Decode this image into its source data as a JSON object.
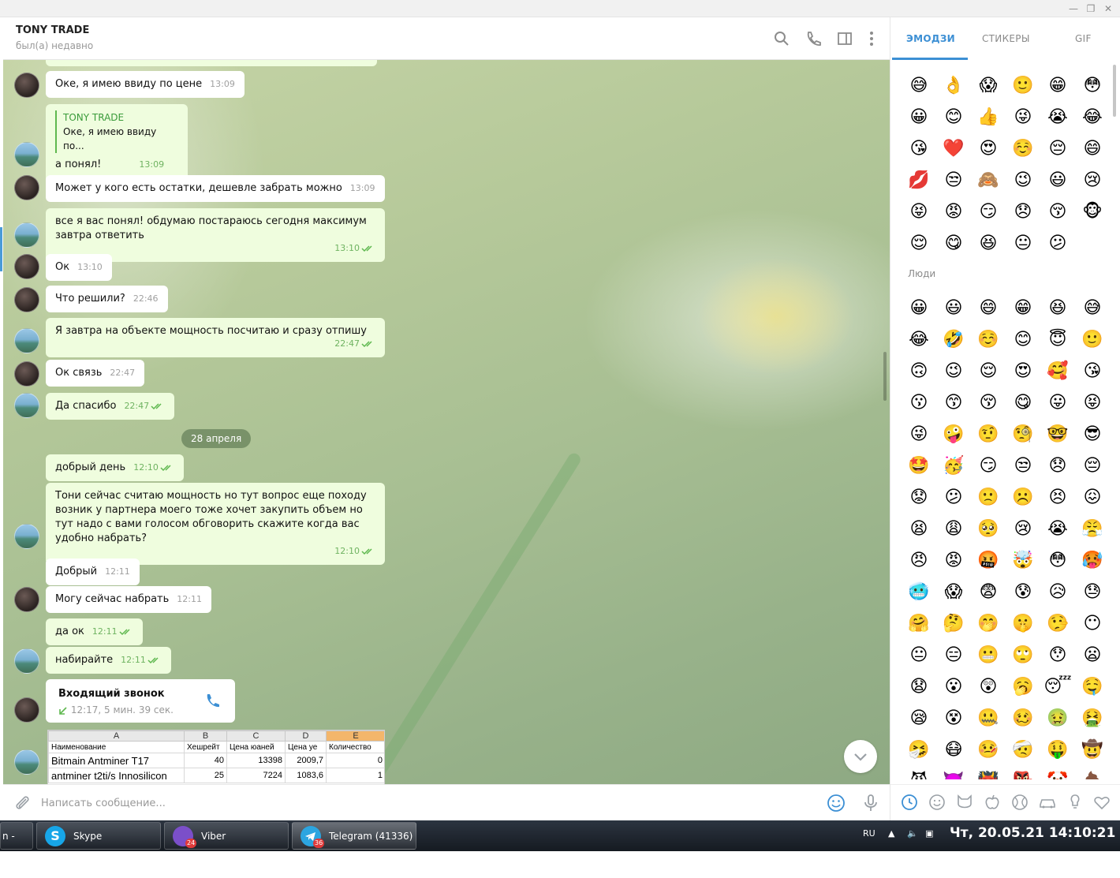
{
  "chat": {
    "title": "TONY TRADE",
    "status": "был(а) недавно"
  },
  "messages": [
    {
      "text": "Оке, я имею ввиду по цене",
      "time": "13:09"
    },
    {
      "reply_name": "TONY TRADE",
      "reply_text": "Оке, я имею ввиду по...",
      "text": "а понял!",
      "time": "13:09"
    },
    {
      "text": "Может у кого есть остатки, дешевле забрать можно",
      "time": "13:09"
    },
    {
      "text": "все я вас понял! обдумаю постараюсь сегодня максимум завтра ответить",
      "time": "13:10"
    },
    {
      "text": "Ок",
      "time": "13:10"
    },
    {
      "text": "Что решили?",
      "time": "22:46"
    },
    {
      "text": "Я завтра на объекте мощность посчитаю и сразу отпишу",
      "time": "22:47"
    },
    {
      "text": "Ок связь",
      "time": "22:47"
    },
    {
      "text": "Да спасибо",
      "time": "22:47"
    },
    {
      "text": "добрый день",
      "time": "12:10"
    },
    {
      "text": "Тони сейчас считаю мощность но тут вопрос еще походу возник у партнера моего тоже хочет закупить объем но тут надо с вами голосом обговорить скажите когда вас удобно набрать?",
      "time": "12:10"
    },
    {
      "text": "Добрый",
      "time": "12:11"
    },
    {
      "text": "Могу сейчас набрать",
      "time": "12:11"
    },
    {
      "text": "да ок",
      "time": "12:11"
    },
    {
      "text": "набирайте",
      "time": "12:11"
    }
  ],
  "date_separator": "28 апреля",
  "call": {
    "title": "Входящий звонок",
    "details": "12:17, 5 мин. 39 сек."
  },
  "spreadsheet": {
    "col_letters": [
      "A",
      "B",
      "C",
      "D",
      "E"
    ],
    "headers": [
      "Наименование",
      "Хешрейт",
      "Цена юаней",
      "Цена уе",
      "Количество"
    ],
    "rows": [
      [
        "Bitmain Antminer T17",
        "40",
        "13398",
        "2009,7",
        "0"
      ],
      [
        "antminer t2ti/s Innosilicon",
        "25",
        "7224",
        "1083,6",
        "1"
      ]
    ]
  },
  "composer": {
    "placeholder": "Написать сообщение..."
  },
  "emoji_panel": {
    "tabs": [
      "ЭМОДЗИ",
      "СТИКЕРЫ",
      "GIF"
    ],
    "people_label": "Люди",
    "recent": [
      "😅",
      "👌",
      "😱",
      "🙂",
      "😁",
      "😳",
      "😀",
      "😊",
      "👍",
      "😜",
      "😭",
      "😂",
      "😘",
      "❤️",
      "😍",
      "☺️",
      "😔",
      "😄",
      "💋",
      "😒",
      "🙈",
      "😉",
      "😃",
      "😢",
      "😝",
      "😡",
      "😏",
      "😞",
      "😚",
      "🐵",
      "😌",
      "😋",
      "😆",
      "😐",
      "😕"
    ],
    "people": [
      "😀",
      "😃",
      "😄",
      "😁",
      "😆",
      "😅",
      "😂",
      "🤣",
      "☺️",
      "😊",
      "😇",
      "🙂",
      "🙃",
      "😉",
      "😌",
      "😍",
      "🥰",
      "😘",
      "😗",
      "😙",
      "😚",
      "😋",
      "😛",
      "😝",
      "😜",
      "🤪",
      "🤨",
      "🧐",
      "🤓",
      "😎",
      "🤩",
      "🥳",
      "😏",
      "😒",
      "😞",
      "😔",
      "😟",
      "😕",
      "🙁",
      "☹️",
      "😣",
      "😖",
      "😫",
      "😩",
      "🥺",
      "😢",
      "😭",
      "😤",
      "😠",
      "😡",
      "🤬",
      "🤯",
      "😳",
      "🥵",
      "🥶",
      "😱",
      "😨",
      "😰",
      "😥",
      "😓",
      "🤗",
      "🤔",
      "🤭",
      "🤫",
      "🤥",
      "😶",
      "😐",
      "😑",
      "😬",
      "🙄",
      "😯",
      "😦",
      "😧",
      "😮",
      "😲",
      "🥱",
      "😴",
      "🤤",
      "😪",
      "😵",
      "🤐",
      "🥴",
      "🤢",
      "🤮",
      "🤧",
      "😷",
      "🤒",
      "🤕",
      "🤑",
      "🤠",
      "😈",
      "👿",
      "👹",
      "👺",
      "🤡",
      "💩"
    ]
  },
  "taskbar": {
    "items": [
      {
        "label": "n - к..."
      },
      {
        "label": "Skype"
      },
      {
        "label": "Viber",
        "badge": "24"
      },
      {
        "label": "Telegram (41336)",
        "badge": "36"
      }
    ],
    "lang": "RU",
    "clock": "Чт, 20.05.21 14:10:21"
  },
  "colors": {
    "accent": "#3c8fd4",
    "outgoing_bubble": "#effdde",
    "check_green": "#5fb84f"
  }
}
